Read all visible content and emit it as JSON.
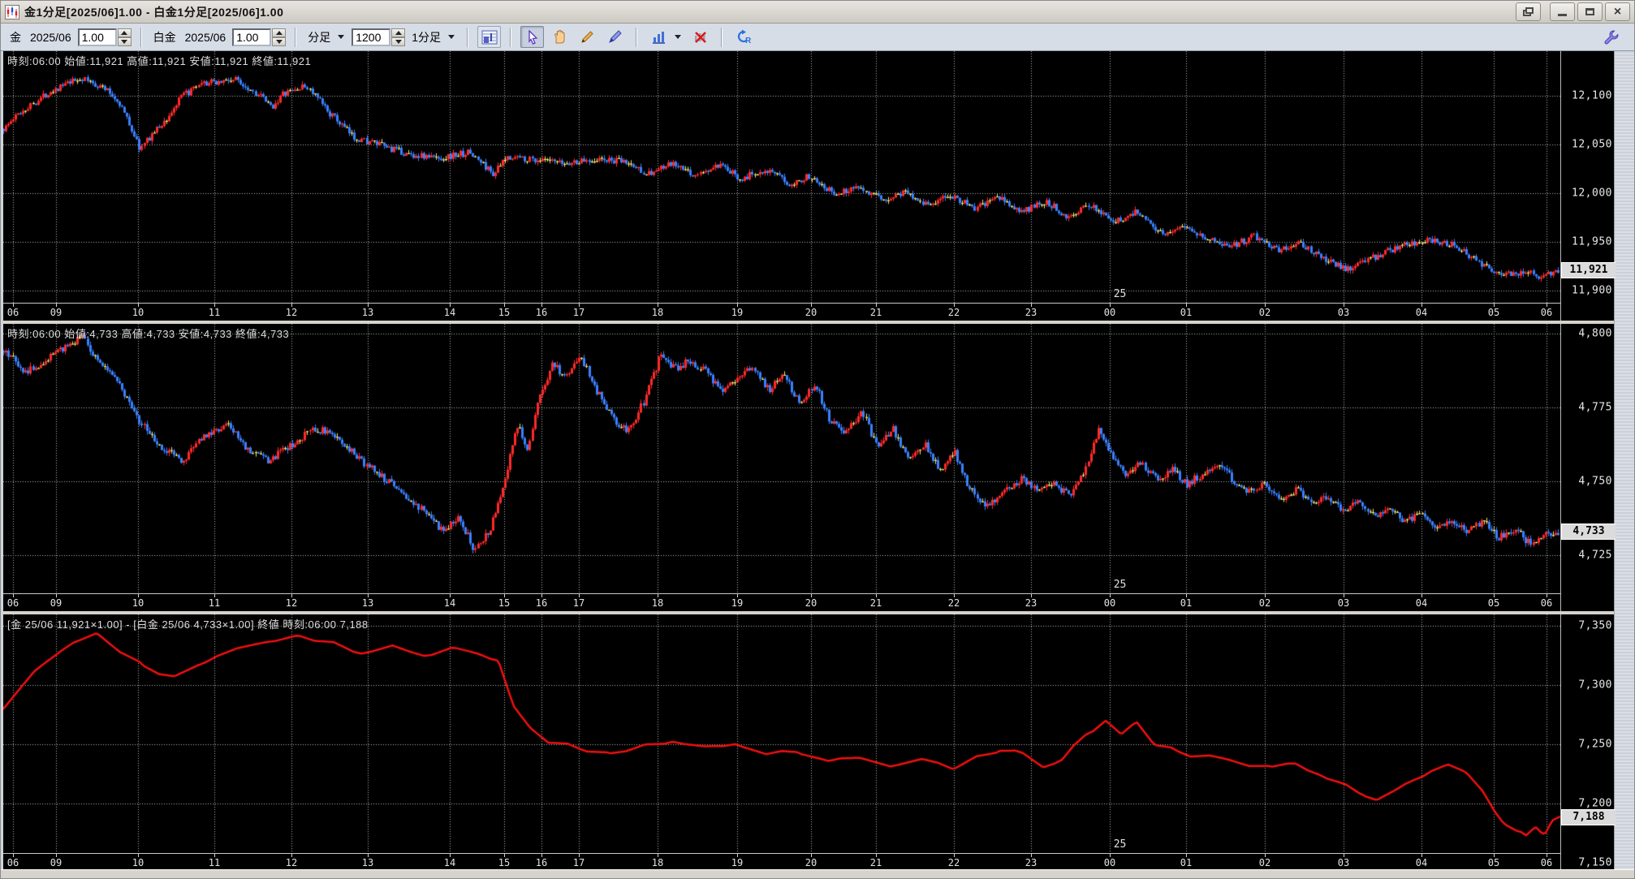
{
  "window": {
    "title": "金1分足[2025/06]1.00 - 白金1分足[2025/06]1.00",
    "buttons": [
      "float-window",
      "minimize",
      "maximize",
      "close"
    ]
  },
  "toolbar": {
    "gold_label": "金",
    "gold_month": "2025/06",
    "gold_ratio": "1.00",
    "platinum_label": "白金",
    "platinum_month": "2025/06",
    "platinum_ratio": "1.00",
    "bar_type_label": "分足",
    "bar_count": "1200",
    "interval_label": "1分足",
    "icons": [
      "chart-settings",
      "select-cursor",
      "hand-pan",
      "pencil-draw",
      "pen-draw",
      "bar-chart-type",
      "delete-drawings",
      "refresh",
      "wrench-settings"
    ]
  },
  "time_axis": {
    "date_label_f": 0.7105,
    "hours": [
      {
        "label": "06",
        "f": 0.006
      },
      {
        "label": "09",
        "f": 0.034
      },
      {
        "label": "10",
        "f": 0.0865
      },
      {
        "label": "11",
        "f": 0.1354
      },
      {
        "label": "12",
        "f": 0.1849
      },
      {
        "label": "13",
        "f": 0.2339
      },
      {
        "label": "14",
        "f": 0.2865
      },
      {
        "label": "15",
        "f": 0.3219
      },
      {
        "label": "16",
        "f": 0.3458
      },
      {
        "label": "17",
        "f": 0.3698
      },
      {
        "label": "18",
        "f": 0.4203
      },
      {
        "label": "19",
        "f": 0.4714
      },
      {
        "label": "20",
        "f": 0.5188
      },
      {
        "label": "21",
        "f": 0.5604
      },
      {
        "label": "22",
        "f": 0.6104
      },
      {
        "label": "23",
        "f": 0.6599
      },
      {
        "label": "00",
        "f": 0.7105
      },
      {
        "label": "01",
        "f": 0.7599
      },
      {
        "label": "02",
        "f": 0.8104
      },
      {
        "label": "03",
        "f": 0.8609
      },
      {
        "label": "04",
        "f": 0.9109
      },
      {
        "label": "05",
        "f": 0.9573
      },
      {
        "label": "06",
        "f": 0.991
      }
    ]
  },
  "panels": [
    {
      "name": "gold",
      "info": "時刻:06:00 始値:11,921 高値:11,921 安値:11,921 終値:11,921",
      "date_label": "25",
      "scale": {
        "top": 12146,
        "bottom": 11887.5
      },
      "axis": {
        "ticks": [
          {
            "label": "12,100",
            "price": 12100
          },
          {
            "label": "12,050",
            "price": 12050
          },
          {
            "label": "12,000",
            "price": 12000
          },
          {
            "label": "11,950",
            "price": 11950
          },
          {
            "label": "11,900",
            "price": 11900
          }
        ],
        "badge": {
          "label": "11,921",
          "price": 11921
        }
      }
    },
    {
      "name": "platinum",
      "info": "時刻:06:00 始値:4,733 高値:4,733 安値:4,733 終値:4,733",
      "date_label": "25",
      "scale": {
        "top": 4803.3,
        "bottom": 4712.1
      },
      "axis": {
        "ticks": [
          {
            "label": "4,800",
            "price": 4800
          },
          {
            "label": "4,775",
            "price": 4775
          },
          {
            "label": "4,750",
            "price": 4750
          },
          {
            "label": "4,725",
            "price": 4725
          }
        ],
        "badge": {
          "label": "4,733",
          "price": 4733
        }
      }
    },
    {
      "name": "spread",
      "info": "[金 25/06 11,921×1.00] - [白金 25/06 4,733×1.00] 終値 時刻:06:00 7,188",
      "date_label": "25",
      "scale": {
        "top": 7359.6,
        "bottom": 7158.2
      },
      "axis": {
        "ticks": [
          {
            "label": "7,350",
            "price": 7350
          },
          {
            "label": "7,300",
            "price": 7300
          },
          {
            "label": "7,250",
            "price": 7250
          },
          {
            "label": "7,200",
            "price": 7200
          },
          {
            "label": "7,150",
            "price": 7150
          }
        ],
        "badge": {
          "label": "7,188",
          "price": 7188
        }
      }
    }
  ],
  "chart_data": [
    {
      "type": "candlestick",
      "title": "金 1分足 2025/06",
      "ylim": [
        11887.5,
        12146
      ],
      "up_color": "#ff2a2a",
      "down_color": "#3a80ff",
      "doji_color": "#f0e070",
      "noise": 7,
      "anchors": [
        [
          0,
          12066
        ],
        [
          0.01,
          12082
        ],
        [
          0.03,
          12105
        ],
        [
          0.05,
          12118
        ],
        [
          0.065,
          12108
        ],
        [
          0.075,
          12092
        ],
        [
          0.082,
          12068
        ],
        [
          0.088,
          12045
        ],
        [
          0.095,
          12060
        ],
        [
          0.105,
          12076
        ],
        [
          0.115,
          12100
        ],
        [
          0.13,
          12113
        ],
        [
          0.15,
          12117
        ],
        [
          0.165,
          12100
        ],
        [
          0.172,
          12088
        ],
        [
          0.18,
          12102
        ],
        [
          0.195,
          12110
        ],
        [
          0.21,
          12082
        ],
        [
          0.225,
          12058
        ],
        [
          0.245,
          12048
        ],
        [
          0.26,
          12040
        ],
        [
          0.28,
          12036
        ],
        [
          0.3,
          12042
        ],
        [
          0.315,
          12020
        ],
        [
          0.325,
          12038
        ],
        [
          0.34,
          12035
        ],
        [
          0.36,
          12030
        ],
        [
          0.38,
          12035
        ],
        [
          0.4,
          12032
        ],
        [
          0.415,
          12020
        ],
        [
          0.43,
          12030
        ],
        [
          0.445,
          12018
        ],
        [
          0.46,
          12028
        ],
        [
          0.475,
          12015
        ],
        [
          0.49,
          12025
        ],
        [
          0.505,
          12010
        ],
        [
          0.52,
          12018
        ],
        [
          0.535,
          11998
        ],
        [
          0.55,
          12008
        ],
        [
          0.565,
          11992
        ],
        [
          0.58,
          12002
        ],
        [
          0.595,
          11988
        ],
        [
          0.61,
          11998
        ],
        [
          0.625,
          11984
        ],
        [
          0.64,
          11996
        ],
        [
          0.655,
          11980
        ],
        [
          0.67,
          11992
        ],
        [
          0.685,
          11976
        ],
        [
          0.7,
          11988
        ],
        [
          0.715,
          11970
        ],
        [
          0.73,
          11982
        ],
        [
          0.745,
          11958
        ],
        [
          0.76,
          11968
        ],
        [
          0.775,
          11952
        ],
        [
          0.79,
          11946
        ],
        [
          0.805,
          11956
        ],
        [
          0.82,
          11942
        ],
        [
          0.835,
          11948
        ],
        [
          0.85,
          11932
        ],
        [
          0.865,
          11922
        ],
        [
          0.875,
          11930
        ],
        [
          0.89,
          11940
        ],
        [
          0.905,
          11948
        ],
        [
          0.92,
          11952
        ],
        [
          0.935,
          11946
        ],
        [
          0.95,
          11928
        ],
        [
          0.965,
          11916
        ],
        [
          0.98,
          11920
        ],
        [
          0.99,
          11914
        ],
        [
          1,
          11921
        ]
      ]
    },
    {
      "type": "candlestick",
      "title": "白金 1分足 2025/06",
      "ylim": [
        4712.1,
        4803.3
      ],
      "up_color": "#ff2a2a",
      "down_color": "#3a80ff",
      "doji_color": "#f0e070",
      "noise": 2.6,
      "anchors": [
        [
          0,
          4794
        ],
        [
          0.015,
          4787
        ],
        [
          0.03,
          4792
        ],
        [
          0.05,
          4799
        ],
        [
          0.062,
          4790
        ],
        [
          0.075,
          4782
        ],
        [
          0.085,
          4772
        ],
        [
          0.1,
          4762
        ],
        [
          0.115,
          4757
        ],
        [
          0.13,
          4766
        ],
        [
          0.145,
          4769
        ],
        [
          0.16,
          4759
        ],
        [
          0.17,
          4757
        ],
        [
          0.185,
          4762
        ],
        [
          0.2,
          4768
        ],
        [
          0.215,
          4765
        ],
        [
          0.23,
          4757
        ],
        [
          0.25,
          4749
        ],
        [
          0.268,
          4741
        ],
        [
          0.283,
          4733
        ],
        [
          0.293,
          4738
        ],
        [
          0.303,
          4727
        ],
        [
          0.313,
          4734
        ],
        [
          0.322,
          4748
        ],
        [
          0.33,
          4770
        ],
        [
          0.337,
          4761
        ],
        [
          0.345,
          4779
        ],
        [
          0.353,
          4790
        ],
        [
          0.362,
          4785
        ],
        [
          0.372,
          4792
        ],
        [
          0.382,
          4780
        ],
        [
          0.392,
          4771
        ],
        [
          0.402,
          4767
        ],
        [
          0.412,
          4777
        ],
        [
          0.422,
          4792
        ],
        [
          0.432,
          4788
        ],
        [
          0.442,
          4791
        ],
        [
          0.452,
          4787
        ],
        [
          0.462,
          4780
        ],
        [
          0.472,
          4785
        ],
        [
          0.482,
          4789
        ],
        [
          0.492,
          4781
        ],
        [
          0.502,
          4786
        ],
        [
          0.512,
          4777
        ],
        [
          0.522,
          4783
        ],
        [
          0.532,
          4770
        ],
        [
          0.542,
          4766
        ],
        [
          0.552,
          4774
        ],
        [
          0.562,
          4761
        ],
        [
          0.572,
          4768
        ],
        [
          0.582,
          4757
        ],
        [
          0.592,
          4763
        ],
        [
          0.602,
          4754
        ],
        [
          0.612,
          4760
        ],
        [
          0.622,
          4747
        ],
        [
          0.632,
          4742
        ],
        [
          0.645,
          4747
        ],
        [
          0.655,
          4751
        ],
        [
          0.665,
          4747
        ],
        [
          0.675,
          4750
        ],
        [
          0.685,
          4745
        ],
        [
          0.695,
          4752
        ],
        [
          0.705,
          4768
        ],
        [
          0.713,
          4759
        ],
        [
          0.722,
          4752
        ],
        [
          0.732,
          4756
        ],
        [
          0.742,
          4751
        ],
        [
          0.752,
          4754
        ],
        [
          0.762,
          4749
        ],
        [
          0.772,
          4753
        ],
        [
          0.782,
          4755
        ],
        [
          0.792,
          4750
        ],
        [
          0.802,
          4746
        ],
        [
          0.812,
          4749
        ],
        [
          0.822,
          4744
        ],
        [
          0.832,
          4747
        ],
        [
          0.842,
          4742
        ],
        [
          0.852,
          4745
        ],
        [
          0.862,
          4740
        ],
        [
          0.872,
          4743
        ],
        [
          0.882,
          4738
        ],
        [
          0.892,
          4741
        ],
        [
          0.902,
          4736
        ],
        [
          0.912,
          4739
        ],
        [
          0.922,
          4735
        ],
        [
          0.932,
          4737
        ],
        [
          0.942,
          4733
        ],
        [
          0.952,
          4736
        ],
        [
          0.962,
          4731
        ],
        [
          0.972,
          4734
        ],
        [
          0.982,
          4729
        ],
        [
          0.992,
          4732
        ],
        [
          1,
          4733
        ]
      ]
    },
    {
      "type": "line",
      "title": "金−白金 サヤ (終値)",
      "ylim": [
        7158.2,
        7359.6
      ],
      "color": "#f01010",
      "noise": 2.5,
      "anchors": [
        [
          0,
          7282
        ],
        [
          0.02,
          7312
        ],
        [
          0.045,
          7336
        ],
        [
          0.06,
          7345
        ],
        [
          0.075,
          7330
        ],
        [
          0.09,
          7315
        ],
        [
          0.11,
          7308
        ],
        [
          0.13,
          7318
        ],
        [
          0.15,
          7332
        ],
        [
          0.17,
          7338
        ],
        [
          0.19,
          7342
        ],
        [
          0.21,
          7336
        ],
        [
          0.23,
          7328
        ],
        [
          0.25,
          7332
        ],
        [
          0.27,
          7326
        ],
        [
          0.29,
          7330
        ],
        [
          0.305,
          7327
        ],
        [
          0.318,
          7322
        ],
        [
          0.328,
          7282
        ],
        [
          0.338,
          7262
        ],
        [
          0.35,
          7252
        ],
        [
          0.37,
          7246
        ],
        [
          0.39,
          7242
        ],
        [
          0.41,
          7248
        ],
        [
          0.43,
          7253
        ],
        [
          0.45,
          7246
        ],
        [
          0.47,
          7250
        ],
        [
          0.49,
          7240
        ],
        [
          0.51,
          7244
        ],
        [
          0.53,
          7236
        ],
        [
          0.55,
          7241
        ],
        [
          0.57,
          7233
        ],
        [
          0.59,
          7238
        ],
        [
          0.61,
          7230
        ],
        [
          0.625,
          7241
        ],
        [
          0.64,
          7246
        ],
        [
          0.655,
          7241
        ],
        [
          0.668,
          7230
        ],
        [
          0.68,
          7236
        ],
        [
          0.695,
          7258
        ],
        [
          0.708,
          7270
        ],
        [
          0.718,
          7257
        ],
        [
          0.728,
          7267
        ],
        [
          0.74,
          7249
        ],
        [
          0.755,
          7243
        ],
        [
          0.77,
          7240
        ],
        [
          0.785,
          7237
        ],
        [
          0.8,
          7233
        ],
        [
          0.815,
          7229
        ],
        [
          0.83,
          7233
        ],
        [
          0.845,
          7226
        ],
        [
          0.858,
          7218
        ],
        [
          0.87,
          7210
        ],
        [
          0.882,
          7204
        ],
        [
          0.893,
          7211
        ],
        [
          0.905,
          7220
        ],
        [
          0.917,
          7228
        ],
        [
          0.928,
          7232
        ],
        [
          0.94,
          7224
        ],
        [
          0.95,
          7210
        ],
        [
          0.958,
          7194
        ],
        [
          0.965,
          7183
        ],
        [
          0.972,
          7176
        ],
        [
          0.978,
          7172
        ],
        [
          0.984,
          7181
        ],
        [
          0.99,
          7175
        ],
        [
          0.995,
          7186
        ],
        [
          1,
          7188
        ]
      ]
    }
  ]
}
